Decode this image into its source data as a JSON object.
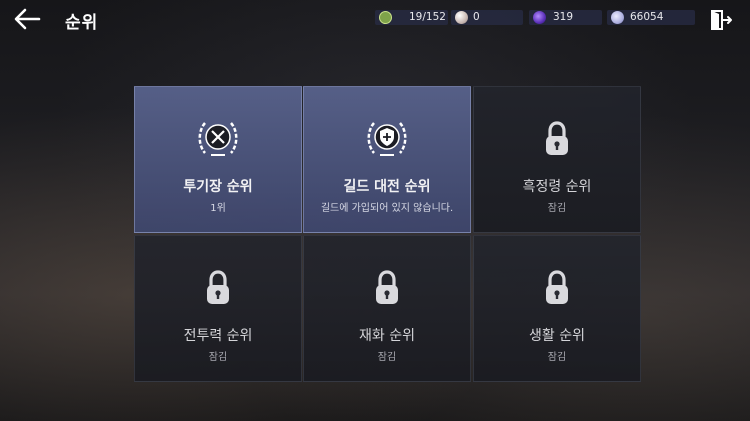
{
  "header": {
    "title": "순위",
    "resources": [
      {
        "icon": "stamina-icon",
        "value": "19/152",
        "color": "#7fa34a"
      },
      {
        "icon": "pearl-icon",
        "value": "0",
        "color": "#d9cfc9"
      },
      {
        "icon": "purple-gem-icon",
        "value": "319",
        "color": "#6b3fc4"
      },
      {
        "icon": "silver-coin-icon",
        "value": "66054",
        "color": "#b7b9e6"
      }
    ]
  },
  "rankings": [
    {
      "name": "투기장 순위",
      "status": "1위",
      "state": "active",
      "icon": "swords-laurel-icon"
    },
    {
      "name": "길드 대전 순위",
      "status": "길드에 가입되어 있지 않습니다.",
      "state": "active",
      "icon": "shield-laurel-icon"
    },
    {
      "name": "흑정령 순위",
      "status": "잠김",
      "state": "locked",
      "icon": "lock-icon"
    },
    {
      "name": "전투력 순위",
      "status": "잠김",
      "state": "locked",
      "icon": "lock-icon"
    },
    {
      "name": "재화 순위",
      "status": "잠김",
      "state": "locked",
      "icon": "lock-icon"
    },
    {
      "name": "생활 순위",
      "status": "잠김",
      "state": "locked",
      "icon": "lock-icon"
    }
  ]
}
